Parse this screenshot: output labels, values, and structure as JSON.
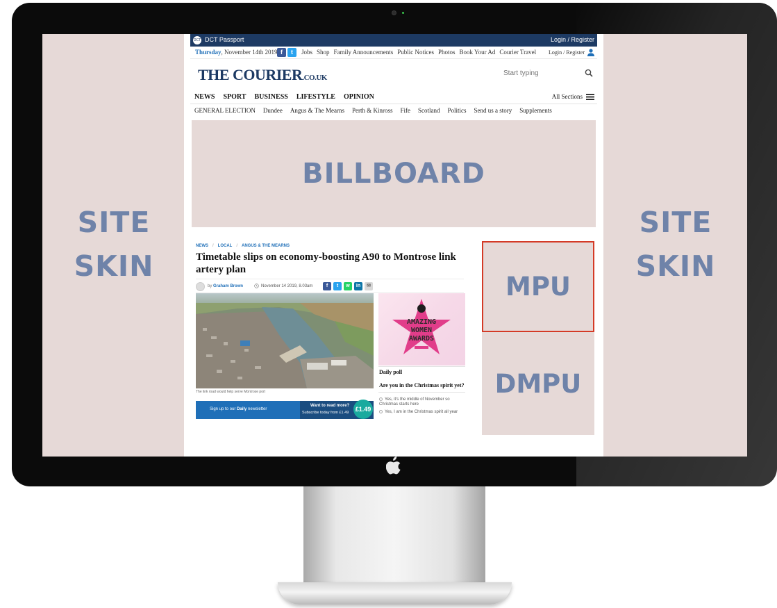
{
  "site_skin": {
    "left_label": "SITE\nSKIN",
    "right_label": "SITE\nSKIN"
  },
  "top_bar": {
    "brand": "DCT Passport",
    "login": "Login / Register"
  },
  "utility": {
    "day": "Thursday",
    "date": ", November 14th 2019",
    "links": [
      "Jobs",
      "Shop",
      "Family Announcements",
      "Public Notices",
      "Photos",
      "Book Your Ad",
      "Courier Travel"
    ],
    "login": "Login / Register"
  },
  "masthead": {
    "logo": "THE COURIER",
    "logo_tld": ".CO.UK",
    "search_placeholder": "Start typing"
  },
  "nav": {
    "items": [
      "NEWS",
      "SPORT",
      "BUSINESS",
      "LIFESTYLE",
      "OPINION"
    ],
    "all_sections": "All Sections"
  },
  "subnav": {
    "items": [
      "GENERAL ELECTION",
      "Dundee",
      "Angus & The Mearns",
      "Perth & Kinross",
      "Fife",
      "Scotland",
      "Politics",
      "Send us a story",
      "Supplements"
    ]
  },
  "billboard": {
    "label": "BILLBOARD"
  },
  "article": {
    "breadcrumbs": [
      "NEWS",
      "LOCAL",
      "ANGUS & THE MEARNS"
    ],
    "headline": "Timetable slips on economy-boosting A90 to Montrose link artery plan",
    "by": "by",
    "author": "Graham Brown",
    "date": "November 14 2019, 8.03am",
    "caption": "The link road would help serve Montrose port",
    "share_icons": [
      "facebook",
      "twitter",
      "whatsapp",
      "linkedin",
      "email"
    ]
  },
  "newsletter": {
    "signup_prefix": "Sign up to our ",
    "signup_bold": "Daily",
    "signup_suffix": " newsletter",
    "cta_title": "Want to read more?",
    "cta_sub": "Subscribe today from £1.49",
    "price": "£1.49"
  },
  "promo": {
    "line1": "AMAZING",
    "line2": "WOMEN",
    "line3": "AWARDS"
  },
  "poll": {
    "title": "Daily poll",
    "question": "Are you in the Christmas spirit yet?",
    "options": [
      "Yes, it's the middle of November so Christmas starts here",
      "Yes, I am in the Christmas spirit all year"
    ]
  },
  "ads": {
    "mpu": "MPU",
    "dmpu": "DMPU"
  },
  "colors": {
    "ad_placeholder_bg": "#e6d9d7",
    "ad_label": "#6f83a9",
    "brand_navy": "#1d3a63",
    "link_blue": "#1f6fb8",
    "mpu_border": "#d43a26"
  }
}
